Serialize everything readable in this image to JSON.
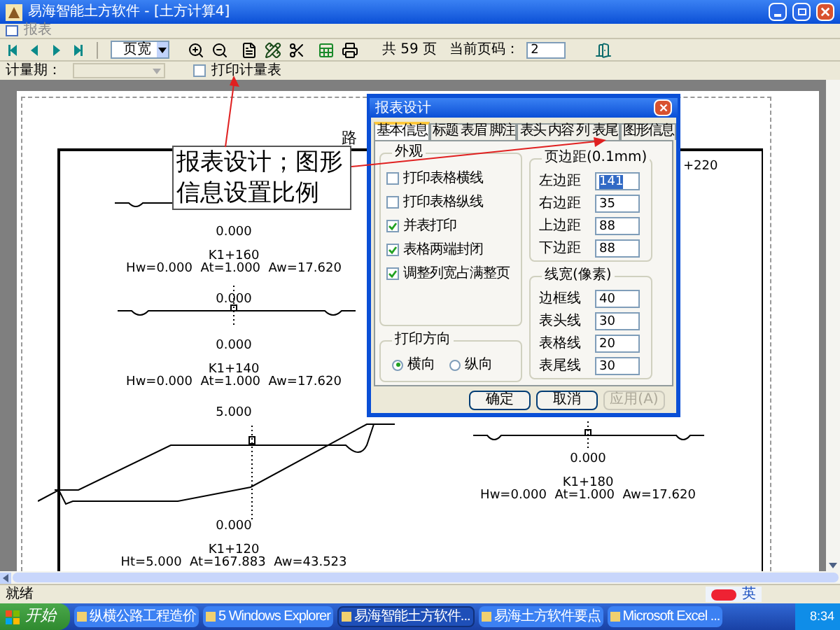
{
  "window": {
    "title": "易海智能土方软件 - [土方计算4]"
  },
  "menu": {
    "items": [
      "报表"
    ]
  },
  "toolbar": {
    "page_mode": "页宽",
    "page_count": "共 59 页",
    "current_page_label": "当前页码：",
    "current_page": "2"
  },
  "toolbar2": {
    "period_label": "计量期：",
    "print_checkbox": {
      "label": "打印计量表",
      "checked": false
    }
  },
  "document": {
    "title_fragment": "路",
    "right_fragment": "+220",
    "sections": [
      {
        "bottom_value": "0.000",
        "station": "K1+160",
        "stats": "Hw=0.000  At=1.000  Aw=17.620"
      },
      {
        "top_value": "0.000",
        "bottom_value": "0.000",
        "station": "K1+140",
        "stats": "Hw=0.000  At=1.000  Aw=17.620"
      },
      {
        "top_value": "5.000",
        "bottom_value": "0.000",
        "station": "K1+120",
        "stats": "Ht=5.000  At=167.883  Aw=43.523"
      },
      {
        "bottom_value": "0.000",
        "station": "K1+180",
        "stats": "Hw=0.000  At=1.000  Aw=17.620"
      }
    ]
  },
  "callout": {
    "lines": [
      "报表设计；图形",
      "信息设置比例"
    ]
  },
  "dialog": {
    "title": "报表设计",
    "tabs": [
      {
        "label": "基本信息",
        "selected": true
      },
      {
        "label": "标题 表眉 脚注",
        "selected": false
      },
      {
        "label": "表头 内容 列 表尾",
        "selected": false
      },
      {
        "label": "图形信息",
        "selected": false
      }
    ],
    "appearance": {
      "title": "外观",
      "options": [
        {
          "label": "打印表格横线",
          "checked": false
        },
        {
          "label": "打印表格纵线",
          "checked": false
        },
        {
          "label": "并表打印",
          "checked": true
        },
        {
          "label": "表格两端封闭",
          "checked": true
        },
        {
          "label": "调整列宽占满整页",
          "checked": true
        }
      ]
    },
    "orientation": {
      "title": "打印方向",
      "options": [
        {
          "label": "横向",
          "selected": true
        },
        {
          "label": "纵向",
          "selected": false
        }
      ]
    },
    "margins": {
      "title": "页边距(0.1mm)",
      "fields": [
        {
          "label": "左边距",
          "value": "141",
          "selected": true
        },
        {
          "label": "右边距",
          "value": "35",
          "selected": false
        },
        {
          "label": "上边距",
          "value": "88",
          "selected": false
        },
        {
          "label": "下边距",
          "value": "88",
          "selected": false
        }
      ]
    },
    "line_widths": {
      "title": "线宽(像素)",
      "fields": [
        {
          "label": "边框线",
          "value": "40",
          "selected": false
        },
        {
          "label": "表头线",
          "value": "30",
          "selected": false
        },
        {
          "label": "表格线",
          "value": "20",
          "selected": false
        },
        {
          "label": "表尾线",
          "value": "30",
          "selected": false
        }
      ]
    },
    "buttons": [
      {
        "label": "确定",
        "disabled": false
      },
      {
        "label": "取消",
        "disabled": false
      },
      {
        "label": "应用(A)",
        "disabled": true
      }
    ]
  },
  "status_bar": {
    "text": "就绪"
  },
  "taskbar": {
    "start": "开始",
    "tasks": [
      {
        "label": "纵横公路工程造价",
        "selected": false
      },
      {
        "label": "5 Windows Explorer",
        "selected": false
      },
      {
        "label": "易海智能土方软件...",
        "selected": true
      },
      {
        "label": "易海土方软件要点",
        "selected": false
      },
      {
        "label": "Microsoft Excel ...",
        "selected": false
      }
    ],
    "ime": "英",
    "clock": "8:34"
  }
}
